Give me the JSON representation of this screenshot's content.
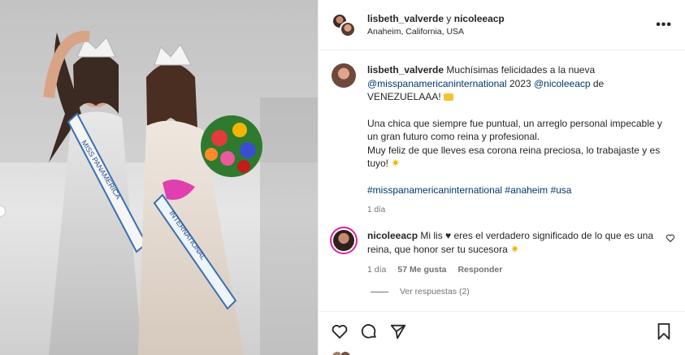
{
  "post": {
    "users_a": "lisbeth_valverde",
    "users_joiner": " y ",
    "users_b": "nicoleeacp",
    "location": "Anaheim, California, USA",
    "more_label": "•••"
  },
  "caption": {
    "author": "lisbeth_valverde",
    "line1_text": " Muchísimas felicidades a la nueva ",
    "mention1": "@misspanamericaninternational",
    "line1_year": " 2023 ",
    "mention2": "@nicoleeacp",
    "line1_de": " de",
    "line2": "VENEZUELAAA!",
    "para2": "Una chica que siempre fue puntual, un arreglo personal impecable y un gran futuro como reina y profesional.",
    "para3": "Muy feliz de que lleves esa corona reina preciosa, lo trabajaste y es tuyo!",
    "hashtags": "#misspanamericaninternational #anaheim #usa",
    "time": "1 día"
  },
  "comment": {
    "author": "nicoleeacp",
    "text_a": " Mi lis ",
    "heart_glyph": "♥",
    "text_b": " eres el verdadero significado de lo que es una reina, que honor ser tu sucesora",
    "time": "1 día",
    "likes": "57 Me gusta",
    "reply_label": "Responder"
  },
  "replies": {
    "label": "Ver respuestas (2)"
  },
  "photo": {
    "sash_left": "MISS PANAMERICA",
    "sash_right": "INTERNATIONAL"
  },
  "colors": {
    "link": "#00376b",
    "muted": "#737373",
    "story_ring": "#d6249f"
  },
  "icons": [
    "heart-icon",
    "comment-icon",
    "share-icon",
    "bookmark-icon",
    "more-icon"
  ]
}
